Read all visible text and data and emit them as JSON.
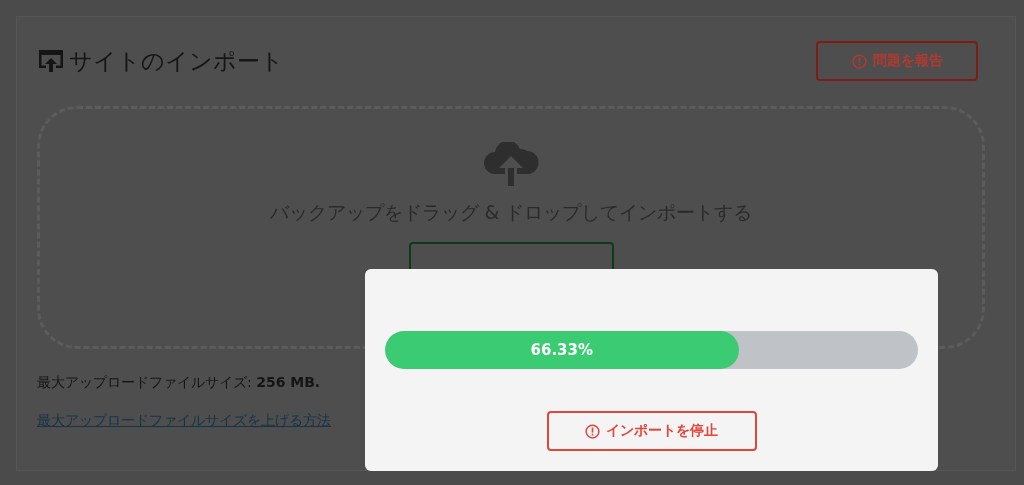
{
  "page": {
    "title": "サイトのインポート",
    "report_button": "問題を報告"
  },
  "dropzone": {
    "prompt": "バックアップをドラッグ & ドロップしてインポートする"
  },
  "max_size": {
    "label": "最大アップロードファイルサイズ: ",
    "value": "256 MB."
  },
  "help_link": "最大アップロードファイルサイズを上げる方法",
  "modal": {
    "progress": {
      "level": 0.6633,
      "reading": "66.33%"
    },
    "stop_button": "インポートを停止"
  }
}
